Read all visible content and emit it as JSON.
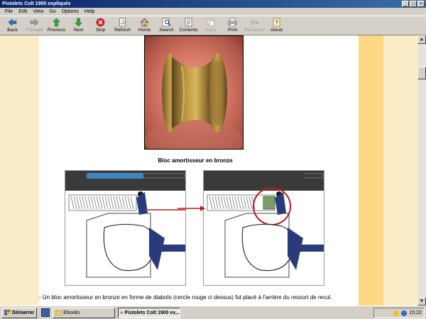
{
  "window": {
    "title": "Pistolets Colt 1900 expliqués",
    "controls": [
      "_",
      "□",
      "×"
    ]
  },
  "menu": [
    "File",
    "Edit",
    "View",
    "Go",
    "Options",
    "Help"
  ],
  "toolbar": [
    {
      "label": "Back",
      "icon": "arrow-left-icon",
      "enabled": true
    },
    {
      "label": "Forward",
      "icon": "arrow-right-icon",
      "enabled": false
    },
    {
      "label": "Previous",
      "icon": "arrow-up-icon",
      "enabled": true
    },
    {
      "label": "Next",
      "icon": "arrow-down-icon",
      "enabled": true
    },
    {
      "label": "Stop",
      "icon": "stop-icon",
      "enabled": true
    },
    {
      "label": "Refresh",
      "icon": "refresh-icon",
      "enabled": true
    },
    {
      "label": "Home",
      "icon": "home-icon",
      "enabled": true
    },
    {
      "label": "Search",
      "icon": "search-icon",
      "enabled": true
    },
    {
      "label": "Contents",
      "icon": "contents-icon",
      "enabled": true
    },
    {
      "label": "Copy",
      "icon": "copy-icon",
      "enabled": false
    },
    {
      "label": "Print",
      "icon": "print-icon",
      "enabled": true
    },
    {
      "label": "Password",
      "icon": "password-icon",
      "enabled": false
    },
    {
      "label": "About",
      "icon": "about-icon",
      "enabled": true
    }
  ],
  "content": {
    "caption": "Bloc amortisseur en bronze",
    "body": "- Un bloc amortisseur en bronze en forme de diabolo (cercle rouge ci dessus) fut placé à l'arrière du ressort de recul."
  },
  "colors": {
    "accent_red": "#c0181c",
    "slide_blue": "#3b86c0",
    "part_navy": "#2a3a7a",
    "bronze": "#9a7a3a",
    "band_light": "#f9ecc6",
    "band_gold": "#fcd982"
  },
  "taskbar": {
    "start_label": "Démarrer",
    "tasks": [
      {
        "label": "Ebooks",
        "active": false
      },
      {
        "label": "Pistolets Colt 1900 ex...",
        "active": true
      }
    ],
    "clock": "15:22"
  }
}
